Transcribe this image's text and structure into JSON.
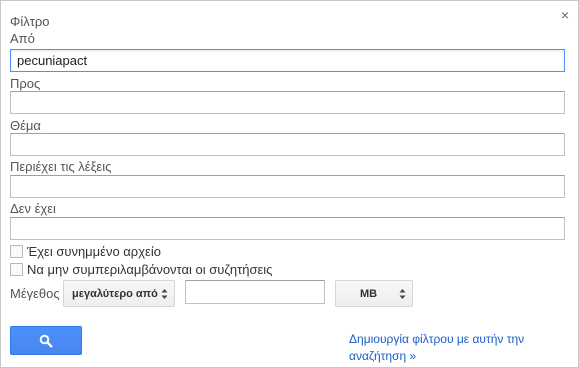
{
  "dialog": {
    "title": "Φίλτρο",
    "close_glyph": "×"
  },
  "fields": {
    "from": {
      "label": "Από",
      "value": "pecuniapact"
    },
    "to": {
      "label": "Προς",
      "value": ""
    },
    "subject": {
      "label": "Θέμα",
      "value": ""
    },
    "has_words": {
      "label": "Περιέχει τις λέξεις",
      "value": ""
    },
    "doesnt_have": {
      "label": "Δεν έχει",
      "value": ""
    }
  },
  "checkboxes": {
    "has_attachment": {
      "label": "Έχει συνημμένο αρχείο",
      "checked": false
    },
    "no_chats": {
      "label": "Να μην συμπεριλαμβάνονται οι συζητήσεις",
      "checked": false
    }
  },
  "size": {
    "label": "Μέγεθος",
    "comparator": "μεγαλύτερο από",
    "value": "",
    "unit": "MB"
  },
  "actions": {
    "search_icon": "search-icon",
    "create_filter_line1": "Δημιουργία φίλτρου με αυτήν την",
    "create_filter_line2": "αναζήτηση »"
  },
  "colors": {
    "accent": "#4d90fe",
    "link": "#1a5cc8"
  }
}
